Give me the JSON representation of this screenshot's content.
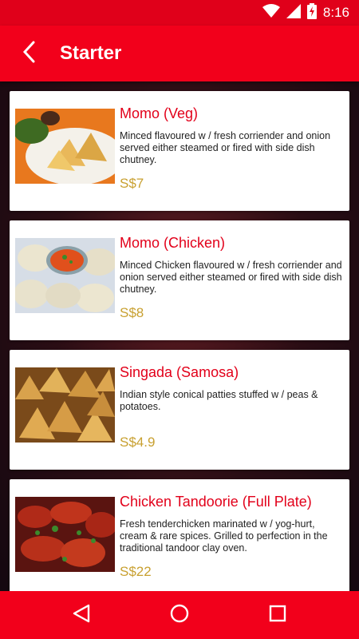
{
  "status_bar": {
    "time": "8:16"
  },
  "app_bar": {
    "title": "Starter"
  },
  "menu_items": [
    {
      "title": "Momo (Veg)",
      "description": "Minced flavoured w / fresh corriender and onion served either steamed or fired with side dish chutney.",
      "price": "S$7"
    },
    {
      "title": "Momo (Chicken)",
      "description": "Minced Chicken flavoured w / fresh corriender and onion served either steamed or fired with side dish chutney.",
      "price": "S$8"
    },
    {
      "title": "Singada (Samosa)",
      "description": "Indian style conical patties stuffed w / peas & potatoes.",
      "price": "S$4.9"
    },
    {
      "title": "Chicken Tandoorie (Full Plate)",
      "description": "Fresh tenderchicken marinated w / yog-hurt, cream & rare spices. Grilled to perfection in the traditional tandoor clay oven.",
      "price": "S$22"
    }
  ],
  "colors": {
    "primary": "#f2001b",
    "title_red": "#e2001a",
    "price_gold": "#c8a030"
  }
}
